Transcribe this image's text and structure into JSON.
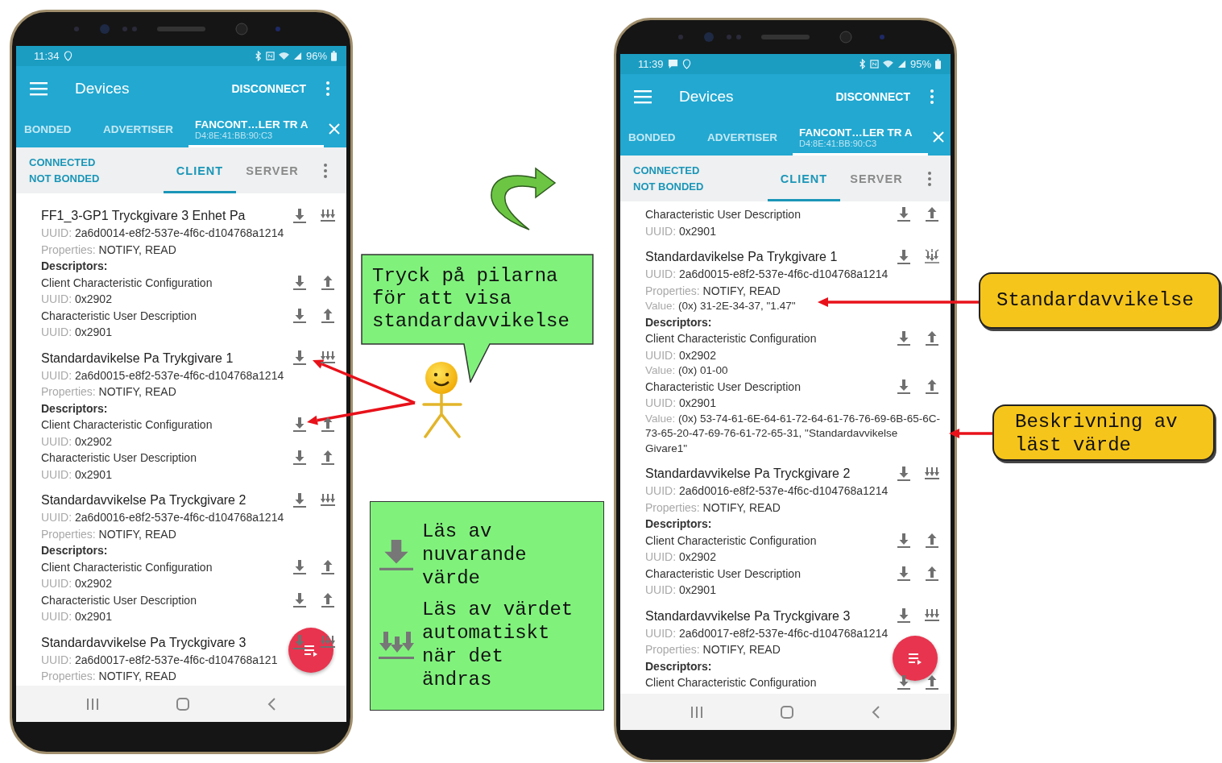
{
  "phones": [
    {
      "status_bar": {
        "time": "11:34",
        "message_icon": false,
        "battery": "96%"
      },
      "app_bar": {
        "title": "Devices",
        "action": "DISCONNECT"
      },
      "tabs": [
        {
          "label": "BONDED",
          "selected": false
        },
        {
          "label": "ADVERTISER",
          "selected": false
        },
        {
          "label": "FANCONT…LER TR A",
          "sublabel": "D4:8E:41:BB:90:C3",
          "selected": true
        }
      ],
      "connection": {
        "state": "CONNECTED",
        "bond": "NOT BONDED"
      },
      "sub_tabs": [
        {
          "label": "CLIENT",
          "selected": true
        },
        {
          "label": "SERVER",
          "selected": false
        }
      ],
      "rows": [
        {
          "kind": "characteristic",
          "name": "FF1_3-GP1 Tryckgivare 3 Enhet Pa",
          "uuid_label": "UUID:",
          "uuid": "2a6d0014-e8f2-537e-4f6c-d104768a1214",
          "properties_label": "Properties:",
          "properties": "NOTIFY, READ",
          "notify_on": false
        },
        {
          "kind": "heading",
          "text": "Descriptors:"
        },
        {
          "kind": "descriptor",
          "name": "Client Characteristic Configuration",
          "uuid_label": "UUID:",
          "uuid": "0x2902"
        },
        {
          "kind": "descriptor",
          "name": "Characteristic User Description",
          "uuid_label": "UUID:",
          "uuid": "0x2901"
        },
        {
          "kind": "characteristic",
          "name": "Standardavikelse Pa Trykgivare 1",
          "uuid_label": "UUID:",
          "uuid": "2a6d0015-e8f2-537e-4f6c-d104768a1214",
          "properties_label": "Properties:",
          "properties": "NOTIFY, READ",
          "notify_on": false
        },
        {
          "kind": "heading",
          "text": "Descriptors:"
        },
        {
          "kind": "descriptor",
          "name": "Client Characteristic Configuration",
          "uuid_label": "UUID:",
          "uuid": "0x2902"
        },
        {
          "kind": "descriptor",
          "name": "Characteristic User Description",
          "uuid_label": "UUID:",
          "uuid": "0x2901"
        },
        {
          "kind": "characteristic",
          "name": "Standardavvikelse Pa Tryckgivare 2",
          "uuid_label": "UUID:",
          "uuid": "2a6d0016-e8f2-537e-4f6c-d104768a1214",
          "properties_label": "Properties:",
          "properties": "NOTIFY, READ",
          "notify_on": false
        },
        {
          "kind": "heading",
          "text": "Descriptors:"
        },
        {
          "kind": "descriptor",
          "name": "Client Characteristic Configuration",
          "uuid_label": "UUID:",
          "uuid": "0x2902"
        },
        {
          "kind": "descriptor",
          "name": "Characteristic User Description",
          "uuid_label": "UUID:",
          "uuid": "0x2901"
        },
        {
          "kind": "characteristic",
          "name": "Standardavvikelse Pa Tryckgivare 3",
          "uuid_label": "UUID:",
          "uuid": "2a6d0017-e8f2-537e-4f6c-d104768a121",
          "properties_label": "Properties:",
          "properties": "NOTIFY, READ",
          "notify_on": false
        }
      ]
    },
    {
      "status_bar": {
        "time": "11:39",
        "message_icon": true,
        "battery": "95%"
      },
      "app_bar": {
        "title": "Devices",
        "action": "DISCONNECT"
      },
      "tabs": [
        {
          "label": "BONDED",
          "selected": false
        },
        {
          "label": "ADVERTISER",
          "selected": false
        },
        {
          "label": "FANCONT…LER TR A",
          "sublabel": "D4:8E:41:BB:90:C3",
          "selected": true
        }
      ],
      "connection": {
        "state": "CONNECTED",
        "bond": "NOT BONDED"
      },
      "sub_tabs": [
        {
          "label": "CLIENT",
          "selected": true
        },
        {
          "label": "SERVER",
          "selected": false
        }
      ],
      "rows": [
        {
          "kind": "descriptor",
          "name": "Characteristic User Description",
          "uuid_label": "UUID:",
          "uuid": "0x2901"
        },
        {
          "kind": "characteristic",
          "name": "Standardavikelse Pa Trykgivare 1",
          "uuid_label": "UUID:",
          "uuid": "2a6d0015-e8f2-537e-4f6c-d104768a1214",
          "properties_label": "Properties:",
          "properties": "NOTIFY, READ",
          "value_label": "Value:",
          "value": "(0x) 31-2E-34-37, \"1.47\"",
          "notify_on": true
        },
        {
          "kind": "heading",
          "text": "Descriptors:"
        },
        {
          "kind": "descriptor",
          "name": "Client Characteristic Configuration",
          "uuid_label": "UUID:",
          "uuid": "0x2902",
          "value_label": "Value:",
          "value": "(0x) 01-00"
        },
        {
          "kind": "descriptor",
          "name": "Characteristic User Description",
          "uuid_label": "UUID:",
          "uuid": "0x2901",
          "value_label": "Value:",
          "value": "(0x) 53-74-61-6E-64-61-72-64-61-76-76-69-6B-65-6C-73-65-20-47-69-76-61-72-65-31, \"Standardavvikelse Givare1\""
        },
        {
          "kind": "characteristic",
          "name": "Standardavvikelse Pa Tryckgivare 2",
          "uuid_label": "UUID:",
          "uuid": "2a6d0016-e8f2-537e-4f6c-d104768a1214",
          "properties_label": "Properties:",
          "properties": "NOTIFY, READ",
          "notify_on": false
        },
        {
          "kind": "heading",
          "text": "Descriptors:"
        },
        {
          "kind": "descriptor",
          "name": "Client Characteristic Configuration",
          "uuid_label": "UUID:",
          "uuid": "0x2902"
        },
        {
          "kind": "descriptor",
          "name": "Characteristic User Description",
          "uuid_label": "UUID:",
          "uuid": "0x2901"
        },
        {
          "kind": "characteristic",
          "name": "Standardavvikelse Pa Tryckgivare 3",
          "uuid_label": "UUID:",
          "uuid": "2a6d0017-e8f2-537e-4f6c-d104768a1214",
          "properties_label": "Properties:",
          "properties": "NOTIFY, READ",
          "notify_on": false
        },
        {
          "kind": "heading",
          "text": "Descriptors:"
        },
        {
          "kind": "descriptor",
          "name": "Client Characteristic Configuration"
        }
      ]
    }
  ],
  "instruction_bubble": {
    "text": "Tryck på pilarna för att visa standardavvikelse"
  },
  "legend": [
    {
      "kind": "read",
      "text": "Läs av nuvarande värde"
    },
    {
      "kind": "notify",
      "text": "Läs av värdet automatiskt när det ändras"
    }
  ],
  "callouts": [
    {
      "text": "Standardavvikelse"
    },
    {
      "text": "Beskrivning av läst värde"
    }
  ]
}
